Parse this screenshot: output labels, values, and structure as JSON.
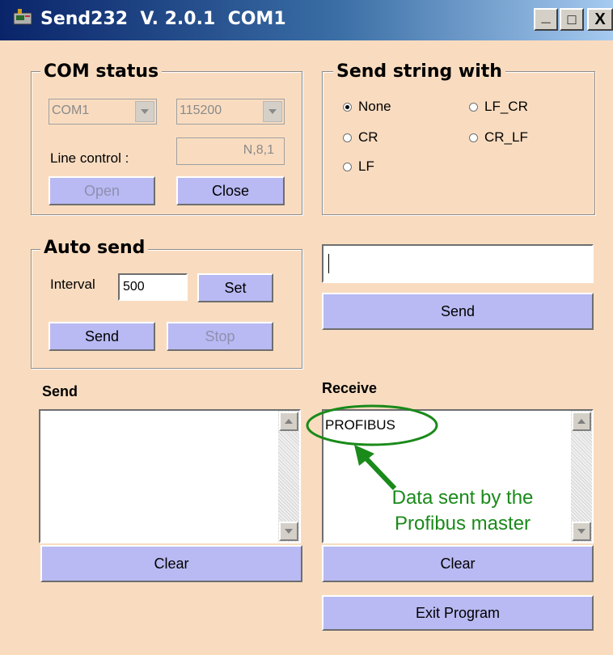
{
  "window": {
    "title": "Send232  V. 2.0.1  COM1",
    "minimize_glyph": "_",
    "maximize_glyph": "□",
    "close_glyph": "X",
    "background_color": "#f9dcc0",
    "button_color": "#b9b9f3",
    "app_icon": "app-window-icon"
  },
  "com_status": {
    "title": "COM status",
    "port": "COM1",
    "baud": "115200",
    "line_control_label": "Line control :",
    "line_control_value": "N,8,1",
    "open_label": "Open",
    "close_label": "Close"
  },
  "send_string_with": {
    "title": "Send string with",
    "options": [
      {
        "label": "None",
        "selected": true
      },
      {
        "label": "CR",
        "selected": false
      },
      {
        "label": "LF",
        "selected": false
      },
      {
        "label": "LF_CR",
        "selected": false
      },
      {
        "label": "CR_LF",
        "selected": false
      }
    ]
  },
  "auto_send": {
    "title": "Auto send",
    "interval_label": "Interval",
    "interval_value": "500",
    "set_label": "Set",
    "send_label": "Send",
    "stop_label": "Stop"
  },
  "manual_send": {
    "input_value": "",
    "send_label": "Send"
  },
  "send_panel": {
    "label": "Send",
    "content": "",
    "clear_label": "Clear"
  },
  "receive_panel": {
    "label": "Receive",
    "content": "PROFIBUS",
    "clear_label": "Clear"
  },
  "annotation": {
    "line1": "Data sent by the",
    "line2": "Profibus master",
    "color": "#1a8a1a"
  },
  "exit_label": "Exit Program"
}
